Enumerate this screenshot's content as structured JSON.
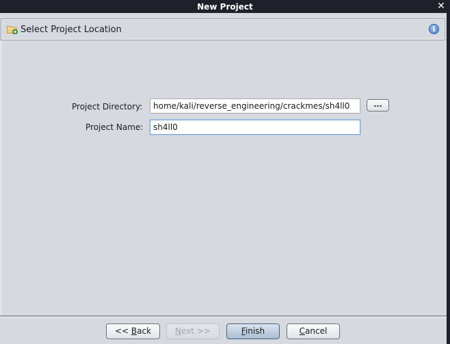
{
  "window": {
    "title": "New Project",
    "close_glyph": "✕"
  },
  "header": {
    "icon": "new-folder-icon",
    "title": "Select Project Location",
    "help_icon": "info-icon",
    "help_glyph": "i"
  },
  "form": {
    "directory_label": "Project Directory:",
    "directory_value": "home/kali/reverse_engineering/crackmes/sh4ll0",
    "browse_label": "...",
    "name_label": "Project Name:",
    "name_value": "sh4ll0"
  },
  "buttons": {
    "back": {
      "prefix": "<< ",
      "mnemonic": "B",
      "rest": "ack",
      "enabled": true
    },
    "next": {
      "prefix": "",
      "mnemonic": "N",
      "rest": "ext >>",
      "enabled": false
    },
    "finish": {
      "prefix": "",
      "mnemonic": "F",
      "rest": "inish",
      "enabled": true,
      "default": true
    },
    "cancel": {
      "prefix": "",
      "mnemonic": "C",
      "rest": "ancel",
      "enabled": true
    }
  },
  "colors": {
    "titlebar": "#1e2129",
    "panel": "#d6d9df",
    "default_button": "#aabcd2",
    "focus_border": "#7da2ce"
  }
}
